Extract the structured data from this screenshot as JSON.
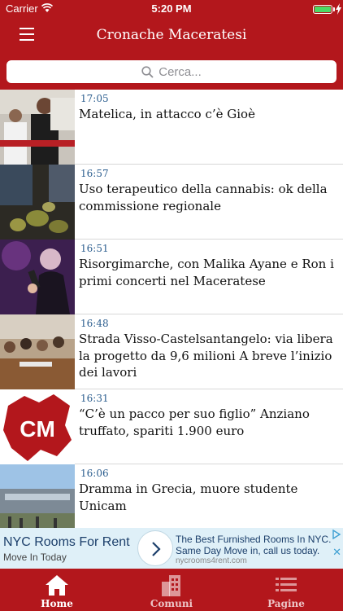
{
  "status_bar": {
    "carrier": "Carrier",
    "time": "5:20 PM"
  },
  "app": {
    "title": "Cronache Maceratesi"
  },
  "search": {
    "placeholder": "Cerca..."
  },
  "news": [
    {
      "time": "17:05",
      "headline": "Matelica, in attacco c’è Gioè",
      "thumb": "player-photo"
    },
    {
      "time": "16:57",
      "headline": "Uso terapeutico della cannabis:  ok della commissione regionale",
      "thumb": "cannabis-photo"
    },
    {
      "time": "16:51",
      "headline": "Risorgimarche, con Malika Ayane e Ron  i primi concerti nel Maceratese",
      "thumb": "singer-photo"
    },
    {
      "time": "16:48",
      "headline": "Strada Visso-Castelsantangelo:  via libera la progetto da 9,6 milioni  A breve l’inizio dei lavori",
      "thumb": "meeting-photo"
    },
    {
      "time": "16:31",
      "headline": "“C’è un pacco per suo figlio”  Anziano truffato, spariti 1.900 euro",
      "thumb": "cm-logo",
      "thumb_text": "CM"
    },
    {
      "time": "16:06",
      "headline": "Dramma in Grecia,  muore studente Unicam",
      "thumb": "campus-photo"
    }
  ],
  "ad": {
    "title": "NYC Rooms For Rent",
    "subtitle": "Move In Today",
    "description": "The Best Furnished Rooms In NYC. Same Day Move in, call us today.",
    "url": "nycrooms4rent.com",
    "close": "✕"
  },
  "tabs": [
    {
      "label": "Home",
      "icon": "home-icon",
      "active": true
    },
    {
      "label": "Comuni",
      "icon": "buildings-icon",
      "active": false
    },
    {
      "label": "Pagine",
      "icon": "list-icon",
      "active": false
    }
  ],
  "colors": {
    "brand": "#b3171c",
    "time_text": "#2c5e8f",
    "ad_background": "#dff0f8"
  }
}
